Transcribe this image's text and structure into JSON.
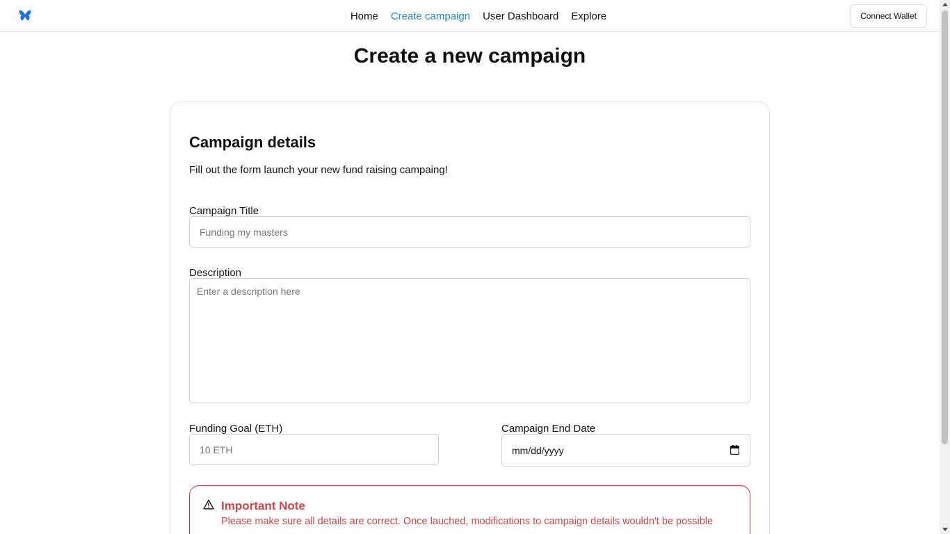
{
  "nav": {
    "logo": "butterfly-logo",
    "links": [
      {
        "label": "Home",
        "active": false
      },
      {
        "label": "Create campaign",
        "active": true
      },
      {
        "label": "User Dashboard",
        "active": false
      },
      {
        "label": "Explore",
        "active": false
      }
    ],
    "connect_label": "Connect Wallet",
    "active_color": "#1d8ad6"
  },
  "page": {
    "title": "Create a new campaign"
  },
  "form": {
    "title": "Campaign details",
    "subtitle": "Fill out the form launch your new fund raising campaing!",
    "campaign_title": {
      "label": "Campaign Title",
      "placeholder": "Funding my masters",
      "value": ""
    },
    "description": {
      "label": "Description",
      "placeholder": "Enter a description here",
      "value": ""
    },
    "funding_goal": {
      "label": "Funding Goal (ETH)",
      "placeholder": "10 ETH",
      "value": ""
    },
    "end_date": {
      "label": "Campaign End Date",
      "display": "mm/dd/yyyy"
    }
  },
  "note": {
    "icon": "warning-triangle-icon",
    "title": "Important Note",
    "text": "Please make sure all details are correct. Once lauched, modifications to campaign details wouldn't be possible",
    "color": "#cc474c"
  }
}
